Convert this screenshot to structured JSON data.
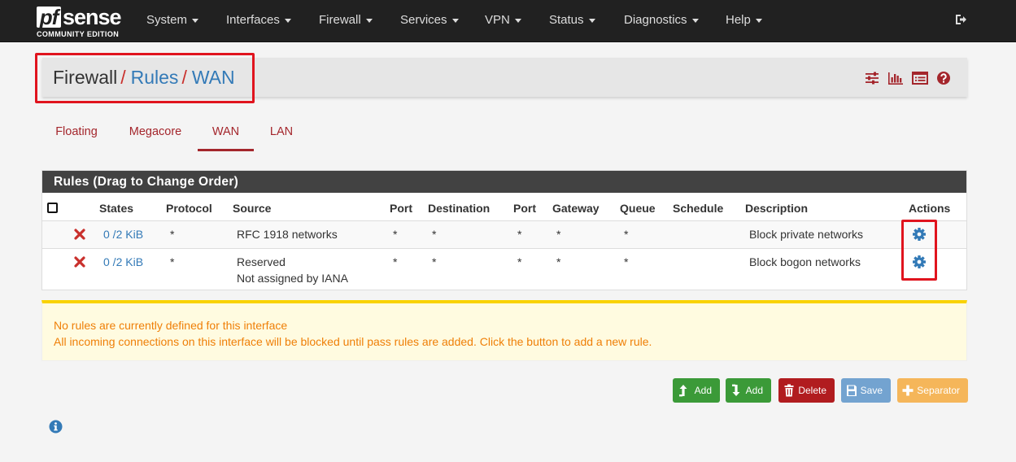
{
  "brand": {
    "pf": "pf",
    "sense": "sense",
    "edition": "COMMUNITY EDITION"
  },
  "nav": {
    "items": [
      {
        "label": "System"
      },
      {
        "label": "Interfaces"
      },
      {
        "label": "Firewall"
      },
      {
        "label": "Services"
      },
      {
        "label": "VPN"
      },
      {
        "label": "Status"
      },
      {
        "label": "Diagnostics"
      },
      {
        "label": "Help"
      }
    ],
    "logout_icon": "sign-out-icon"
  },
  "breadcrumb": {
    "section": "Firewall",
    "separator": "/",
    "page": "Rules",
    "current": "WAN",
    "icons": [
      "sliders-icon",
      "bar-chart-icon",
      "table-list-icon",
      "help-circle-icon"
    ]
  },
  "tabs": [
    {
      "label": "Floating",
      "active": false
    },
    {
      "label": "Megacore",
      "active": false
    },
    {
      "label": "WAN",
      "active": true
    },
    {
      "label": "LAN",
      "active": false
    }
  ],
  "rules_panel": {
    "title": "Rules (Drag to Change Order)",
    "columns": [
      "States",
      "Protocol",
      "Source",
      "Port",
      "Destination",
      "Port",
      "Gateway",
      "Queue",
      "Schedule",
      "Description",
      "Actions"
    ],
    "rows": [
      {
        "status_icon": "block-x-icon",
        "states": "0 /2 KiB",
        "protocol": "*",
        "source": "RFC 1918 networks",
        "source_extra": "",
        "port": "*",
        "destination": "*",
        "dest_port": "*",
        "gateway": "*",
        "queue": "*",
        "schedule": "",
        "description": "Block private networks",
        "action_icon": "gear-icon"
      },
      {
        "status_icon": "block-x-icon",
        "states": "0 /2 KiB",
        "protocol": "*",
        "source": "Reserved",
        "source_extra": "Not assigned by IANA",
        "port": "*",
        "destination": "*",
        "dest_port": "*",
        "gateway": "*",
        "queue": "*",
        "schedule": "",
        "description": "Block bogon networks",
        "action_icon": "gear-icon"
      }
    ]
  },
  "alert": {
    "line1": "No rules are currently defined for this interface",
    "line2": "All incoming connections on this interface will be blocked until pass rules are added. Click the button to add a new rule."
  },
  "buttons": {
    "add_top": "Add",
    "add_bottom": "Add",
    "delete": "Delete",
    "save": "Save",
    "separator": "Separator"
  },
  "colors": {
    "navbar": "#212121",
    "accent_red": "#a4262c",
    "link_blue": "#337ab7",
    "panel_header": "#424242",
    "alert_text": "#ef7f07",
    "highlight_box": "#e0141e"
  }
}
